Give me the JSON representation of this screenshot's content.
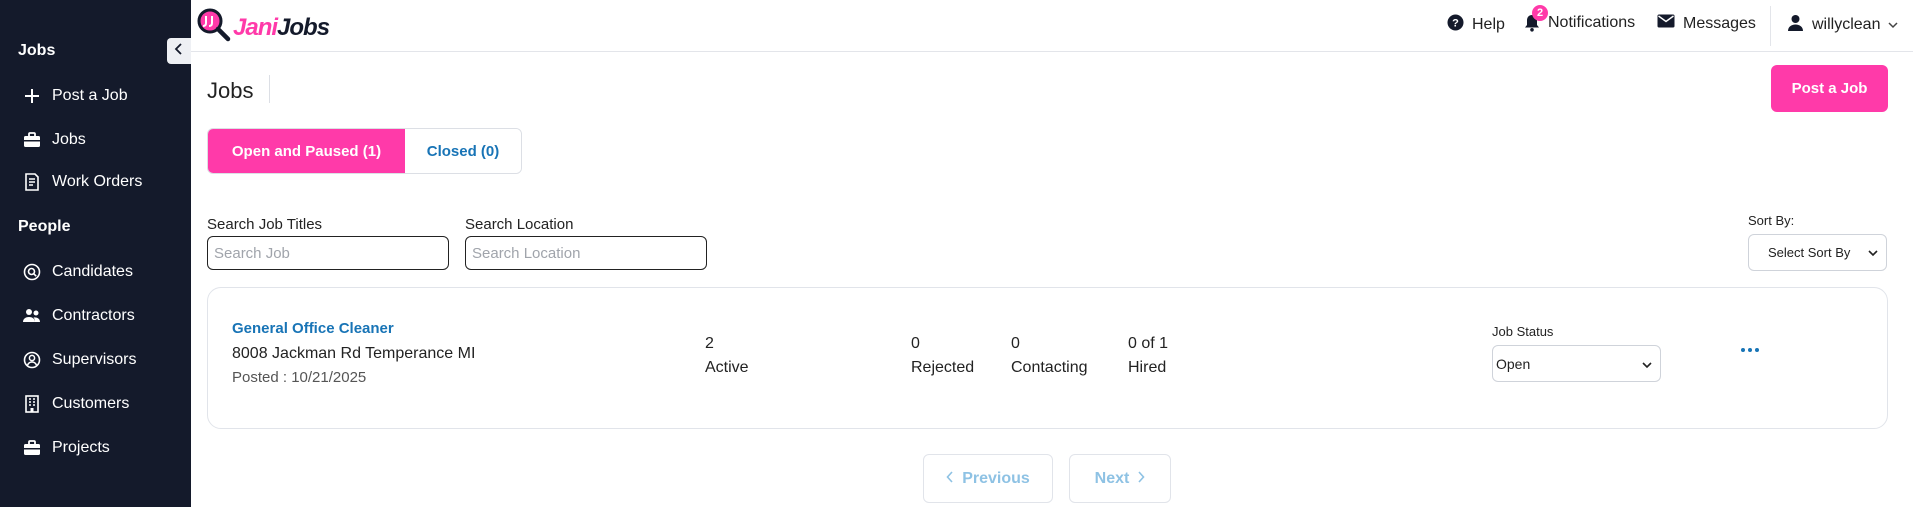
{
  "sidebar": {
    "section_jobs": "Jobs",
    "section_people": "People",
    "items": [
      {
        "label": "Post a Job",
        "icon": "plus-icon"
      },
      {
        "label": "Jobs",
        "icon": "briefcase-icon"
      },
      {
        "label": "Work Orders",
        "icon": "document-icon"
      },
      {
        "label": "Candidates",
        "icon": "search-circle-icon"
      },
      {
        "label": "Contractors",
        "icon": "users-icon"
      },
      {
        "label": "Supervisors",
        "icon": "user-circle-icon"
      },
      {
        "label": "Customers",
        "icon": "building-icon"
      },
      {
        "label": "Projects",
        "icon": "briefcase-icon"
      }
    ]
  },
  "header": {
    "logo_part1": "Jani",
    "logo_part2": "Jobs",
    "help": "Help",
    "notifications": "Notifications",
    "notification_count": "2",
    "messages": "Messages",
    "username": "willyclean"
  },
  "main": {
    "title": "Jobs",
    "post_button": "Post a Job",
    "tabs": [
      {
        "label": "Open and Paused (1)",
        "active": true
      },
      {
        "label": "Closed (0)",
        "active": false
      }
    ],
    "search_titles_label": "Search Job Titles",
    "search_titles_placeholder": "Search Job",
    "search_location_label": "Search Location",
    "search_location_placeholder": "Search Location",
    "sort_label": "Sort By:",
    "sort_value": "Select Sort By"
  },
  "job": {
    "title": "General Office Cleaner",
    "address": "8008 Jackman Rd Temperance MI",
    "posted": "Posted : 10/21/2025",
    "stats": [
      {
        "value": "2",
        "label": "Active"
      },
      {
        "value": "0",
        "label": "Rejected"
      },
      {
        "value": "0",
        "label": "Contacting"
      },
      {
        "value": "0 of 1",
        "label": "Hired"
      }
    ],
    "status_label": "Job Status",
    "status_value": "Open"
  },
  "pagination": {
    "previous": "Previous",
    "next": "Next"
  },
  "colors": {
    "brand_pink": "#ff3aa9",
    "sidebar_bg": "#141a2b",
    "link_blue": "#1874b6"
  }
}
